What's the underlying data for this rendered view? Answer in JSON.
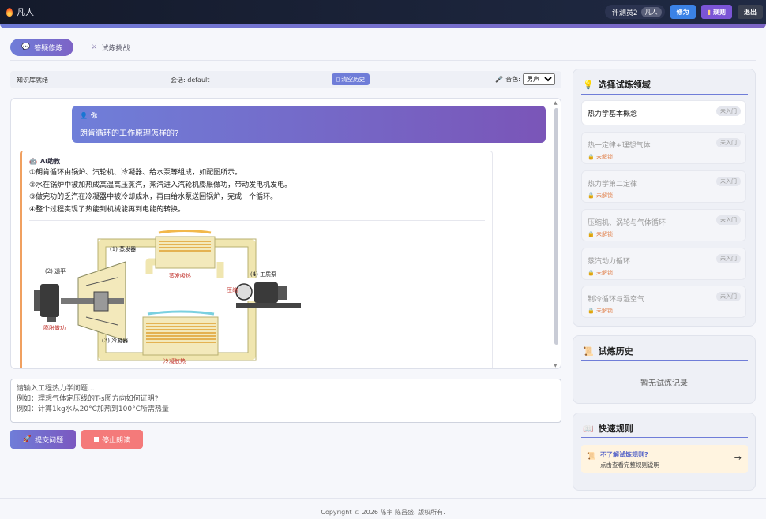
{
  "app": {
    "title": "凡人"
  },
  "topbar": {
    "user_name": "评测员2",
    "user_level": "凡人",
    "buttons": [
      {
        "label": "修为",
        "color": "#3b82e6"
      },
      {
        "label": "规则",
        "color": "#7b55d6"
      },
      {
        "label": "退出",
        "color": "#3a4050"
      }
    ]
  },
  "tabs": [
    {
      "label": "答疑修炼",
      "active": true,
      "icon": "chat-bubble-icon"
    },
    {
      "label": "试炼挑战",
      "active": false,
      "icon": "crossed-swords-icon"
    }
  ],
  "status": {
    "kb": "知识库就绪",
    "session": "会话: default",
    "clear_label": "清空历史",
    "voice_label": "音色:",
    "voice_value": "男声"
  },
  "chat": {
    "user_label": "你",
    "user_question": "朗肯循环的工作原理怎样的?",
    "ai_label": "AI助教",
    "ai_lines": [
      "①朗肯循环由锅炉、汽轮机、冷凝器、给水泵等组成，如配图所示。",
      "②水在锅炉中被加热成高温高压蒸汽，蒸汽进入汽轮机膨胀做功，带动发电机发电。",
      "③做完功的乏汽在冷凝器中被冷却成水，再由给水泵送回锅炉，完成一个循环。",
      "④整个过程实现了热能到机械能再到电能的转换。"
    ],
    "diagram_labels": {
      "evap": "(1) 蒸发器",
      "turbine": "(2) 透平",
      "condenser": "(3) 冷凝器",
      "pump": "(4) 工质泵",
      "evap_heat": "蒸发吸热",
      "expand": "膨胀做功",
      "compress": "压缩",
      "cond_heat": "冷凝放热"
    }
  },
  "input": {
    "placeholder": "请输入工程热力学问题...\n例如：理想气体定压线的T-s图方向如何证明?\n例如：计算1kg水从20°C加热到100°C所需热量"
  },
  "actions": {
    "submit": {
      "label": "提交问题",
      "color": "#7b63c6"
    },
    "stop": {
      "label": "停止朗读",
      "color": "#f47a7a"
    }
  },
  "domains_panel": {
    "title": "选择试炼领域",
    "items": [
      {
        "name": "热力学基本概念",
        "badge": "未入门",
        "locked": false
      },
      {
        "name": "热一定律+理想气体",
        "badge": "未入门",
        "locked": true
      },
      {
        "name": "热力学第二定律",
        "badge": "未入门",
        "locked": true
      },
      {
        "name": "压缩机、涡轮与气体循环",
        "badge": "未入门",
        "locked": true
      },
      {
        "name": "蒸汽动力循环",
        "badge": "未入门",
        "locked": true
      },
      {
        "name": "制冷循环与湿空气",
        "badge": "未入门",
        "locked": true
      }
    ],
    "lock_label": "未解锁"
  },
  "history_panel": {
    "title": "试炼历史",
    "empty": "暂无试炼记录"
  },
  "rules_panel": {
    "title": "快速规则",
    "link_title": "不了解试炼规则?",
    "link_sub": "点击查看完整规则说明",
    "arrow": "→"
  },
  "footer": {
    "text": "Copyright © 2026 陈宇 陈昌盛. 版权所有."
  }
}
